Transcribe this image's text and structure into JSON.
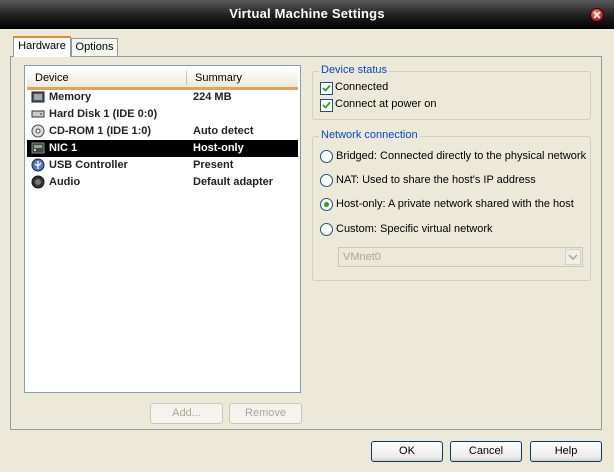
{
  "window": {
    "title": "Virtual Machine Settings"
  },
  "tabs": [
    {
      "label": "Hardware",
      "active": true
    },
    {
      "label": "Options",
      "active": false
    }
  ],
  "device_list": {
    "columns": [
      "Device",
      "Summary"
    ],
    "rows": [
      {
        "device": "Memory",
        "summary": "224 MB",
        "icon": "memory-icon"
      },
      {
        "device": "Hard Disk 1 (IDE 0:0)",
        "summary": "",
        "icon": "hard-disk-icon"
      },
      {
        "device": "CD-ROM 1 (IDE 1:0)",
        "summary": "Auto detect",
        "icon": "cdrom-icon"
      },
      {
        "device": "NIC 1",
        "summary": "Host-only",
        "icon": "network-icon",
        "selected": true
      },
      {
        "device": "USB Controller",
        "summary": "Present",
        "icon": "usb-icon"
      },
      {
        "device": "Audio",
        "summary": "Default adapter",
        "icon": "audio-icon"
      }
    ]
  },
  "list_buttons": {
    "add": "Add...",
    "remove": "Remove"
  },
  "device_status": {
    "legend": "Device status",
    "connected": {
      "label": "Connected",
      "checked": true
    },
    "connect_at_power_on": {
      "label": "Connect at power on",
      "checked": true
    }
  },
  "network_connection": {
    "legend": "Network connection",
    "options": [
      {
        "label": "Bridged: Connected directly to the physical network",
        "selected": false
      },
      {
        "label": "NAT: Used to share the host's IP address",
        "selected": false
      },
      {
        "label": "Host-only: A private network shared with the host",
        "selected": true
      },
      {
        "label": "Custom: Specific virtual network",
        "selected": false
      }
    ],
    "custom_network_value": "VMnet0"
  },
  "dialog_buttons": {
    "ok": "OK",
    "cancel": "Cancel",
    "help": "Help"
  },
  "colors": {
    "selection": "#000000",
    "accent": "#e68b2c",
    "legend": "#0046d5"
  }
}
